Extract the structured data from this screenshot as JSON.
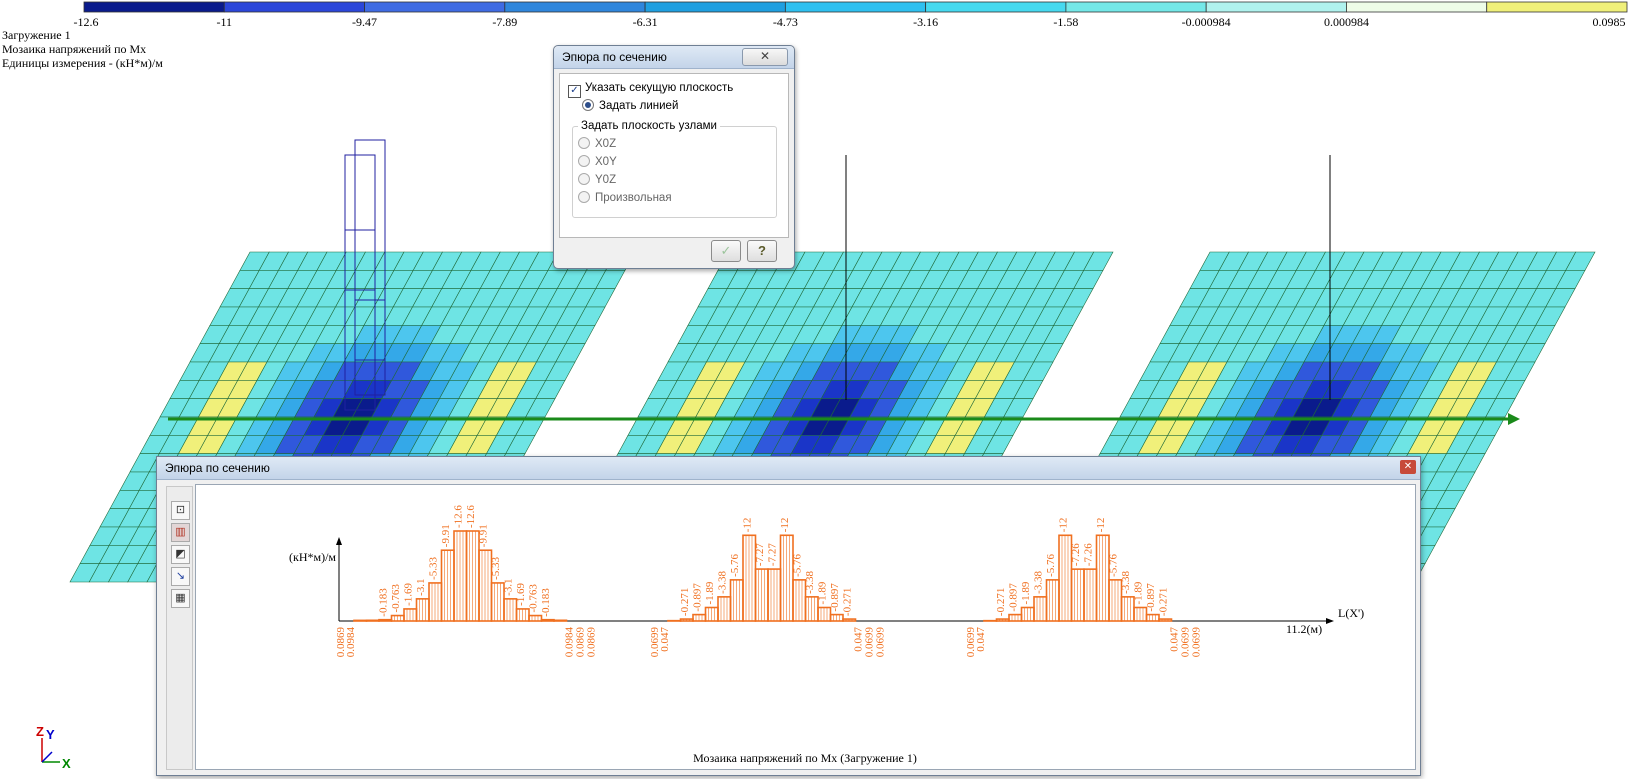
{
  "legend": {
    "values": [
      "-12.6",
      "-11",
      "-9.47",
      "-7.89",
      "-6.31",
      "-4.73",
      "-3.16",
      "-1.58",
      "-0.000984",
      "0.000984",
      "0.0985"
    ],
    "colors": [
      "#0a1b8c",
      "#2b46d9",
      "#3f6be3",
      "#2f86dc",
      "#1f9fe0",
      "#2ec0f0",
      "#46d9ef",
      "#74e8e8",
      "#b0f2ee",
      "#eefce8",
      "#f0f07a"
    ]
  },
  "info": {
    "line1": "Загружение 1",
    "line2": "Мозаика напряжений по Mx",
    "line3": "Единицы измерения - (кН*м)/м"
  },
  "colors": {
    "plate_fill": "#6ee4e4",
    "plate_line": "#1f6a3a",
    "diagram": "#f07020",
    "section_line": "#1a8a1a",
    "column": "#2020a0"
  },
  "dialog": {
    "title": "Эпюра по сечению",
    "checkbox_label": "Указать секущую плоскость",
    "checkbox_checked": true,
    "radio_line": "Задать линией",
    "group_label": "Задать плоскость узлами",
    "opt_xoz": "X0Z",
    "opt_xoy": "X0Y",
    "opt_yoz": "Y0Z",
    "opt_arbitrary": "Произвольная",
    "ok_icon": "check-icon",
    "help_icon": "question-icon",
    "help_label": "?"
  },
  "panel": {
    "title": "Эпюра по сечению",
    "caption": "Мозаика напряжений по Mx (Загружение 1)",
    "tools": [
      "select-icon",
      "diagram-icon",
      "shade-icon",
      "pointer-icon",
      "grid-icon"
    ]
  },
  "chart_data": {
    "type": "bar",
    "ylabel": "(кН*м)/м",
    "xlabel": "L(X')",
    "x_end_label": "11.2(м)",
    "segments": [
      {
        "above": [
          0.0869,
          0.0984,
          0.183,
          0.763,
          1.69,
          3.1,
          5.33,
          9.91,
          12.6,
          12.6,
          9.91,
          5.33,
          3.1,
          1.69,
          0.763,
          0.183,
          0.0984
        ],
        "labels_top": [
          "-0.183",
          "-0.763",
          "-1.69",
          "-3.1",
          "-5.33",
          "-9.91",
          "-12.6",
          "-12.6",
          "-9.91",
          "-5.33",
          "-3.1",
          "-1.69",
          "-0.763",
          "-0.183"
        ],
        "labels_bottom_left": [
          "0.0869",
          "0.0984"
        ],
        "labels_bottom_right": [
          "0.0984",
          "0.0869",
          "0.0869"
        ]
      },
      {
        "above": [
          0.047,
          0.271,
          0.897,
          1.89,
          3.38,
          5.76,
          12,
          7.27,
          7.27,
          12,
          5.76,
          3.38,
          1.89,
          0.897,
          0.271
        ],
        "labels_top": [
          "-0.271",
          "-0.897",
          "-1.89",
          "-3.38",
          "-5.76",
          "-12",
          "-7.27",
          "-7.27",
          "-12",
          "-5.76",
          "-3.38",
          "-1.89",
          "-0.897",
          "-0.271"
        ],
        "labels_bottom_left": [
          "0.0699",
          "0.047"
        ],
        "labels_bottom_right": [
          "0.047",
          "0.0699",
          "0.0699"
        ]
      },
      {
        "above": [
          0.047,
          0.271,
          0.897,
          1.89,
          3.38,
          5.76,
          12,
          7.26,
          7.26,
          12,
          5.76,
          3.38,
          1.89,
          0.897,
          0.271
        ],
        "labels_top": [
          "-0.271",
          "-0.897",
          "-1.89",
          "-3.38",
          "-5.76",
          "-12",
          "-7.26",
          "-7.26",
          "-12",
          "-5.76",
          "-3.38",
          "-1.89",
          "-0.897",
          "-0.271"
        ],
        "labels_bottom_left": [
          "0.0699",
          "0.047"
        ],
        "labels_bottom_right": [
          "0.047",
          "0.0699",
          "0.0699"
        ]
      }
    ]
  }
}
